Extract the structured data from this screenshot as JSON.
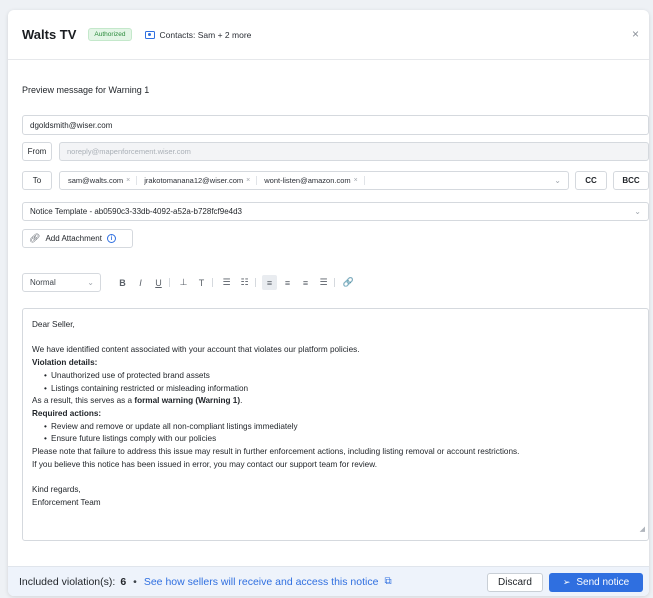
{
  "header": {
    "brand": "Walts TV",
    "badge": "Authorized",
    "contacts": "Contacts: Sam + 2 more",
    "close": "×"
  },
  "preview_title": "Preview message for Warning 1",
  "recipient": "dgoldsmith@wiser.com",
  "from": {
    "label": "From",
    "value": "noreply@mapenforcement.wiser.com"
  },
  "to": {
    "label": "To",
    "chips": [
      "sam@walts.com",
      "jrakotomanana12@wiser.com",
      "wont-listen@amazon.com"
    ],
    "cc": "CC",
    "bcc": "BCC"
  },
  "template": "Notice Template - ab0590c3-33db-4092-a52a-b728fcf9e4d3",
  "attachment": {
    "label": "Add Attachment"
  },
  "toolbar": {
    "format": "Normal",
    "bold": "B",
    "italic": "I",
    "underline": "U",
    "subscript": "⊥",
    "superscript": "T",
    "ordered_list": "☰",
    "bullet_list": "☷",
    "align_left": "≡",
    "align_center": "≡",
    "align_right": "≡",
    "justify": "☰",
    "link": "🔗"
  },
  "body": {
    "greeting": "Dear Seller,",
    "intro": "We have identified content associated with your account that violates our platform policies.",
    "violation_heading": "Violation details:",
    "violations": [
      "Unauthorized use of protected brand assets",
      "Listings containing restricted or misleading information"
    ],
    "result_prefix": "As a result, this serves as a ",
    "result_bold": "formal warning (Warning 1)",
    "result_suffix": ".",
    "required_heading": "Required actions:",
    "actions": [
      "Review and remove or update all non-compliant listings immediately",
      "Ensure future listings comply with our policies"
    ],
    "note": "Please note that failure to address this issue may result in further enforcement actions, including listing removal or account restrictions.",
    "error_note": "If you believe this notice has been issued in error, you may contact our support team for review.",
    "signoff": "Kind regards,",
    "team": "Enforcement Team"
  },
  "footer": {
    "label": "Included violation(s):",
    "count": "6",
    "dot": "•",
    "link": "See how sellers will receive and access this notice",
    "discard": "Discard",
    "send": "Send notice"
  },
  "colors": {
    "accent": "#2f6fe0",
    "badge_bg": "#e3f5e6",
    "badge_text": "#2a8a3b"
  }
}
